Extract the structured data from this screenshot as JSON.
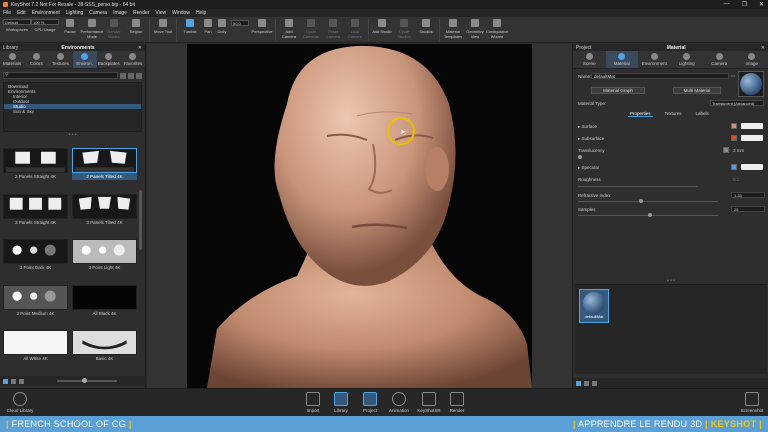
{
  "window": {
    "title": "KeyShot 7.2 Not For Resale - 38-SSS_perso.bip - 64 bit",
    "controls": [
      "—",
      "❐",
      "✕"
    ]
  },
  "menu": [
    "File",
    "Edit",
    "Environment",
    "Lighting",
    "Camera",
    "Image",
    "Render",
    "View",
    "Window",
    "Help"
  ],
  "toolbar": {
    "workspace_sel": "Default",
    "cpu_sel": "100 %",
    "workspaces": "Workspaces",
    "cpu_usage": "CPU Usage",
    "pause": "Pause",
    "performance_mode": "Performance Mode",
    "render_nodes": "Render Nodes",
    "region": "Region",
    "move_tool": "Move Tool",
    "tumble": "Tumble",
    "pan": "Pan",
    "dolly": "Dolly",
    "fov_value": "50.0",
    "perspective": "Perspective",
    "add_camera": "Add Camera",
    "cycle_cameras": "Cycle Cameras",
    "reset_camera": "Reset Camera",
    "lock_camera": "Lock Camera",
    "add_studio": "Add Studio",
    "cycle_studios": "Cycle Studios",
    "studios": "Studios",
    "material_templates": "Material Templates",
    "geometry_view": "Geometry View",
    "configurator_wizard": "Configurator Wizard"
  },
  "library": {
    "header": "Library",
    "section": "Environments",
    "tabs": [
      "Materials",
      "Colors",
      "Textures",
      "Environ.",
      "Backplates",
      "Favorites"
    ],
    "active_tab": 3,
    "tree": [
      {
        "label": "Download",
        "level": 0
      },
      {
        "label": "Environments",
        "level": 0
      },
      {
        "label": "Interior",
        "level": 1
      },
      {
        "label": "Outdoor",
        "level": 1
      },
      {
        "label": "Studio",
        "level": 1,
        "selected": true
      },
      {
        "label": "Sun & Sky",
        "level": 1
      }
    ],
    "thumbnails": [
      {
        "label": "2 Panels Straight 4K",
        "kind": "panels"
      },
      {
        "label": "2 Panels Tilted 4K",
        "kind": "panels-tilted",
        "selected": true
      },
      {
        "label": "3 Panels Straight 4K",
        "kind": "panels3"
      },
      {
        "label": "3 Panels Tilted 4K",
        "kind": "panels3-tilted"
      },
      {
        "label": "3 Point Dark 4K",
        "kind": "dots-dark"
      },
      {
        "label": "3 Point Light 4K",
        "kind": "dots-light"
      },
      {
        "label": "3 Point Medium 4K",
        "kind": "dots-medium"
      },
      {
        "label": "All Black 4K",
        "kind": "black"
      },
      {
        "label": "All White 4K",
        "kind": "white"
      },
      {
        "label": "Basic 4K",
        "kind": "basic"
      }
    ]
  },
  "project": {
    "header": "Project",
    "section": "Material",
    "tabs": [
      "Scene",
      "Material",
      "Environment",
      "Lighting",
      "Camera",
      "Image"
    ],
    "active_tab": 1,
    "name_label": "Name:",
    "name_value": "defaultMat",
    "material_graph": "Material Graph",
    "multi_material": "Multi Material",
    "material_type_label": "Material Type:",
    "material_type_value": "Translucent (Advanced)",
    "subtabs": [
      "Properties",
      "Textures",
      "Labels"
    ],
    "properties": {
      "surface": "Surface",
      "subsurface": "Subsurface",
      "translucency": "Translucency",
      "translucency_value": "3 mm",
      "specular": "Specular",
      "roughness": "Roughness",
      "roughness_value": "0.1",
      "refractive_index": "Refractive Index",
      "refractive_index_value": "1.33",
      "samples": "Samples",
      "samples_value": "25"
    },
    "material_thumb": "defaultMat"
  },
  "bottom": {
    "cloud_library": "Cloud Library",
    "import": "Import",
    "library": "Library",
    "project": "Project",
    "animation": "Animation",
    "keyshotxr": "KeyShotXR",
    "render": "Render",
    "screenshot": "Screenshot"
  },
  "banner": {
    "left": "FRENCH SCHOOL OF CG",
    "right": "APPRENDRE LE RENDU 3D",
    "brand": "KEYSHOT"
  },
  "colors": {
    "accent": "#4ea3e3",
    "subsurface": "#e04a1f",
    "banner": "#5aa0d6",
    "cursor": "#e6c200"
  }
}
